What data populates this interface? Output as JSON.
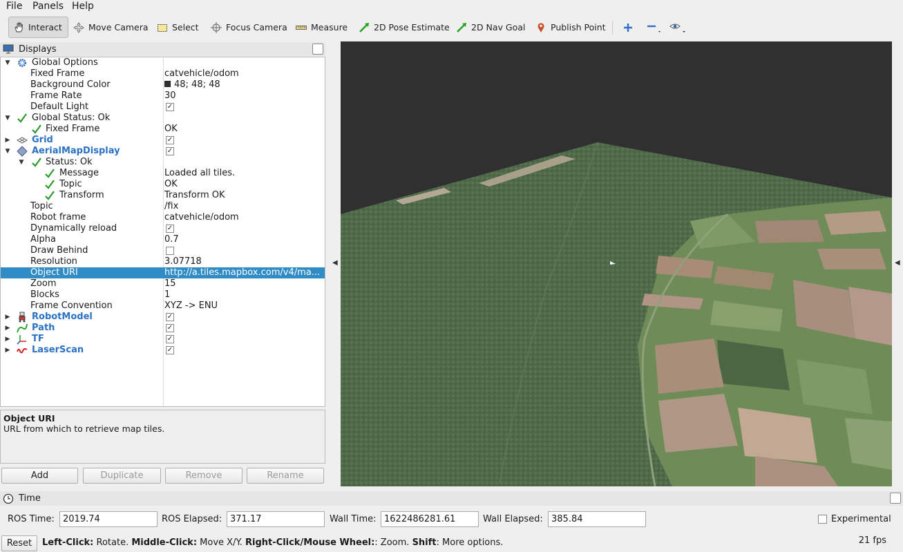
{
  "menu": {
    "file": "File",
    "panels": "Panels",
    "help": "Help"
  },
  "toolbar": {
    "interact": "Interact",
    "move_camera": "Move Camera",
    "select": "Select",
    "focus_camera": "Focus Camera",
    "measure": "Measure",
    "pose_estimate": "2D Pose Estimate",
    "nav_goal": "2D Nav Goal",
    "publish_point": "Publish Point"
  },
  "displays": {
    "title": "Displays",
    "rows": [
      {
        "name": "Global Options",
        "value": ""
      },
      {
        "name": "Fixed Frame",
        "value": "catvehicle/odom"
      },
      {
        "name": "Background Color",
        "value": "48; 48; 48"
      },
      {
        "name": "Frame Rate",
        "value": "30"
      },
      {
        "name": "Default Light",
        "value": ""
      },
      {
        "name": "Global Status: Ok",
        "value": ""
      },
      {
        "name": "Fixed Frame",
        "value": "OK"
      },
      {
        "name": "Grid",
        "value": ""
      },
      {
        "name": "AerialMapDisplay",
        "value": ""
      },
      {
        "name": "Status: Ok",
        "value": ""
      },
      {
        "name": "Message",
        "value": "Loaded all tiles."
      },
      {
        "name": "Topic",
        "value": "OK"
      },
      {
        "name": "Transform",
        "value": "Transform OK"
      },
      {
        "name": "Topic",
        "value": "/fix"
      },
      {
        "name": "Robot frame",
        "value": "catvehicle/odom"
      },
      {
        "name": "Dynamically reload",
        "value": ""
      },
      {
        "name": "Alpha",
        "value": "0.7"
      },
      {
        "name": "Draw Behind",
        "value": ""
      },
      {
        "name": "Resolution",
        "value": "3.07718"
      },
      {
        "name": "Object URI",
        "value": "http://a.tiles.mapbox.com/v4/ma..."
      },
      {
        "name": "Zoom",
        "value": "15"
      },
      {
        "name": "Blocks",
        "value": "1"
      },
      {
        "name": "Frame Convention",
        "value": "XYZ -> ENU"
      },
      {
        "name": "RobotModel",
        "value": ""
      },
      {
        "name": "Path",
        "value": ""
      },
      {
        "name": "TF",
        "value": ""
      },
      {
        "name": "LaserScan",
        "value": ""
      }
    ],
    "checkmark": "✓"
  },
  "description": {
    "title": "Object URI",
    "text": "URL from which to retrieve map tiles."
  },
  "buttons": {
    "add": "Add",
    "duplicate": "Duplicate",
    "remove": "Remove",
    "rename": "Rename"
  },
  "time": {
    "title": "Time",
    "ros_time_label": "ROS Time:",
    "ros_time": "2019.74",
    "ros_elapsed_label": "ROS Elapsed:",
    "ros_elapsed": "371.17",
    "wall_time_label": "Wall Time:",
    "wall_time": "1622486281.61",
    "wall_elapsed_label": "Wall Elapsed:",
    "wall_elapsed": "385.84",
    "experimental": "Experimental"
  },
  "status": {
    "reset": "Reset",
    "hint_1b": "Left-Click:",
    "hint_1": " Rotate. ",
    "hint_2b": "Middle-Click:",
    "hint_2": " Move X/Y. ",
    "hint_3b": "Right-Click/Mouse Wheel:",
    "hint_3": ": Zoom. ",
    "hint_4b": "Shift",
    "hint_4": ": More options.",
    "fps": "21 fps"
  },
  "colors": {
    "background": "#303030",
    "selection": "#308cc6",
    "display_name": "#2b72c6"
  }
}
